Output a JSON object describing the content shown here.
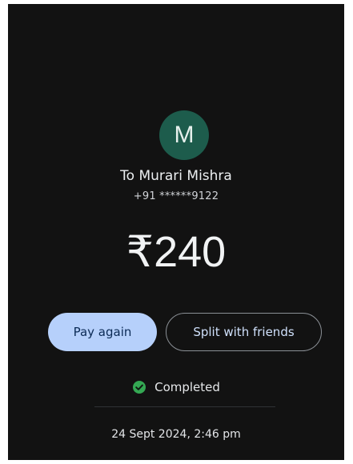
{
  "recipient": {
    "avatar_initial": "M",
    "name_line": "To Murari Mishra",
    "phone": "+91 ******9122"
  },
  "payment": {
    "amount": "₹240"
  },
  "actions": {
    "pay_again_label": "Pay again",
    "split_label": "Split with friends"
  },
  "status": {
    "text": "Completed",
    "icon": "check-circle-icon"
  },
  "timestamp": "24 Sept 2024, 2:46 pm",
  "colors": {
    "background": "#121212",
    "avatar_bg": "#1d5c4c",
    "primary_button": "#b6d0fb",
    "success_green": "#34a853"
  }
}
